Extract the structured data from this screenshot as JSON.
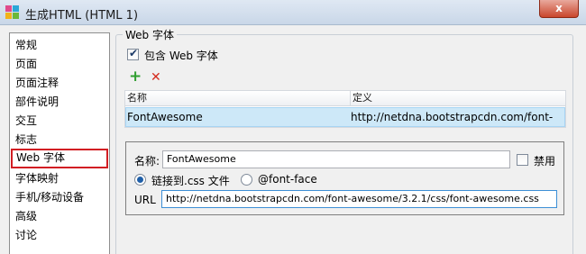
{
  "window": {
    "title": "生成HTML (HTML 1)",
    "close_label": "x"
  },
  "sidebar": {
    "items": [
      {
        "label": "常规"
      },
      {
        "label": "页面"
      },
      {
        "label": "页面注释"
      },
      {
        "label": "部件说明"
      },
      {
        "label": "交互"
      },
      {
        "label": "标志"
      },
      {
        "label": "Web 字体",
        "selected": true
      },
      {
        "label": "字体映射"
      },
      {
        "label": "手机/移动设备"
      },
      {
        "label": "高级"
      },
      {
        "label": "讨论"
      }
    ]
  },
  "webfont": {
    "group_title": "Web 字体",
    "include_label": "包含 Web 字体",
    "include_checked": true,
    "add_icon": "+",
    "remove_icon": "✕",
    "table": {
      "headers": [
        "名称",
        "定义"
      ],
      "rows": [
        {
          "name": "FontAwesome",
          "definition": "http://netdna.bootstrapcdn.com/font-"
        }
      ]
    },
    "detail": {
      "name_label": "名称:",
      "name_value": "FontAwesome",
      "disable_label": "禁用",
      "disable_checked": false,
      "link_css_label": "链接到.css 文件",
      "link_css_selected": true,
      "fontface_label": "@font-face",
      "url_label": "URL",
      "url_value": "http://netdna.bootstrapcdn.com/font-awesome/3.2.1/css/font-awesome.css"
    }
  },
  "colors": {
    "accent": "#d21e23",
    "selection": "#cde8f8",
    "add": "#2f9e2f",
    "remove": "#d42b1e"
  }
}
